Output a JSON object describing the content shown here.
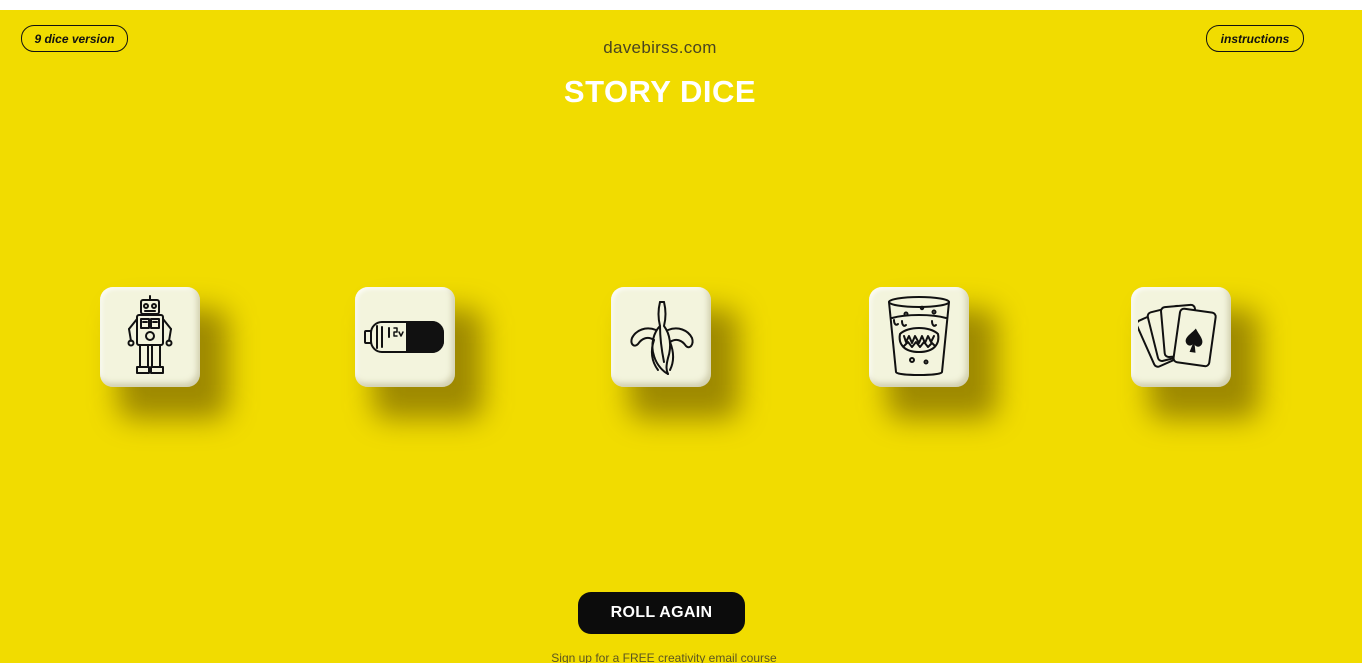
{
  "header": {
    "dice_version_label": "9 dice version",
    "instructions_label": "instructions",
    "site_name": "davebirss.com",
    "title": "STORY DICE"
  },
  "dice": [
    {
      "icon": "robot-icon"
    },
    {
      "icon": "battery-icon"
    },
    {
      "icon": "banana-icon"
    },
    {
      "icon": "teeth-in-glass-icon"
    },
    {
      "icon": "playing-cards-icon"
    }
  ],
  "footer": {
    "roll_label": "ROLL AGAIN",
    "signup_text": "Sign up for a FREE creativity email course"
  },
  "colors": {
    "background": "#f1dc00",
    "die_face": "#f3f4dd",
    "button": "#0c0c0c",
    "title": "#ffffff"
  }
}
